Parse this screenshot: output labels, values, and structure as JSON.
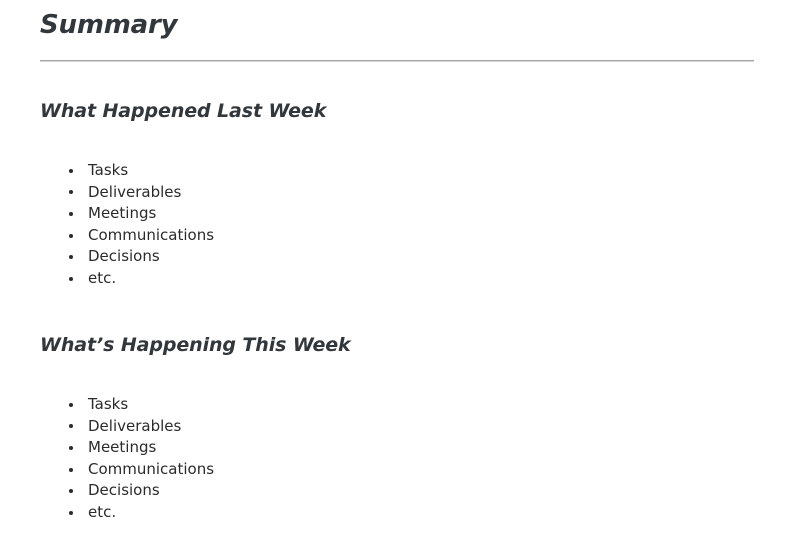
{
  "document": {
    "title": "Summary",
    "background_color": "#ffffff",
    "heading_color": "#32373c",
    "body_text_color": "#2b2b2b",
    "divider": {
      "name": "horizontal-rule",
      "top_color": "#a8a8a8",
      "bottom_color": "#d4d4d4"
    }
  },
  "sections": [
    {
      "heading": "What Happened Last Week",
      "items": [
        "Tasks",
        "Deliverables",
        "Meetings",
        "Communications",
        "Decisions",
        "etc."
      ]
    },
    {
      "heading": "What’s Happening This Week",
      "items": [
        "Tasks",
        "Deliverables",
        "Meetings",
        "Communications",
        "Decisions",
        "etc."
      ]
    }
  ]
}
